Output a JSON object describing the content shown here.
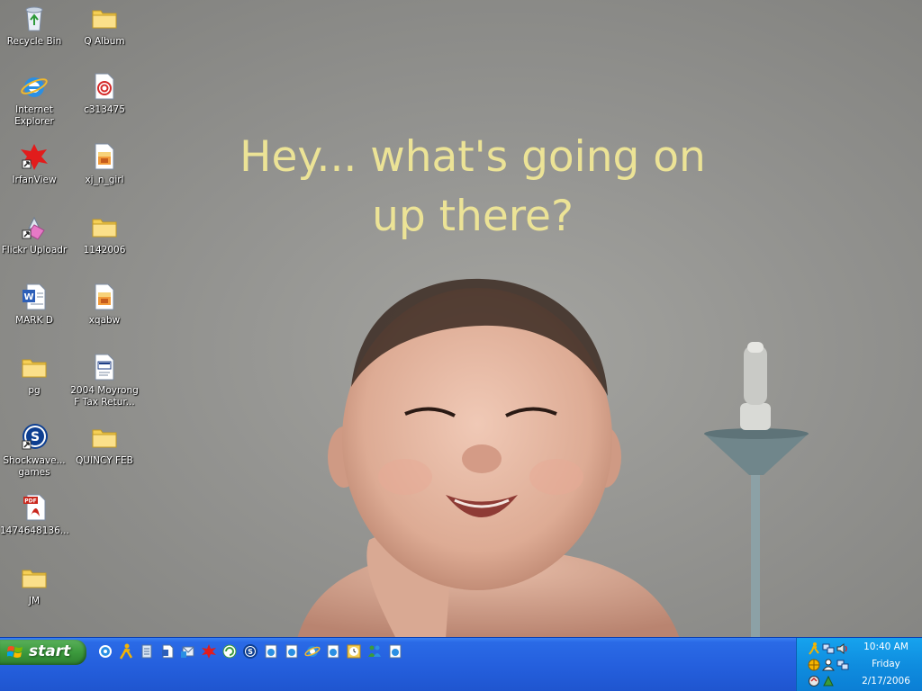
{
  "wallpaper": {
    "caption_line1": "Hey... what's going on",
    "caption_line2": "up there?"
  },
  "desktop_icons": [
    {
      "label": "Recycle Bin",
      "icon": "recycle-bin-icon"
    },
    {
      "label": "Q Album",
      "icon": "folder-icon"
    },
    {
      "label": "Internet Explorer",
      "icon": "internet-explorer-icon"
    },
    {
      "label": "c313475",
      "icon": "document-icon"
    },
    {
      "label": "IrfanView",
      "icon": "irfanview-icon"
    },
    {
      "label": "xj_n_girl",
      "icon": "image-file-icon"
    },
    {
      "label": "Flickr Uploadr",
      "icon": "flickr-uploadr-icon"
    },
    {
      "label": "1142006",
      "icon": "folder-icon"
    },
    {
      "label": "MARK D",
      "icon": "word-document-icon"
    },
    {
      "label": "xqabw",
      "icon": "image-file-icon"
    },
    {
      "label": "pg",
      "icon": "folder-icon"
    },
    {
      "label": "2004 Moyrong F Tax Retur...",
      "icon": "tax-document-icon"
    },
    {
      "label": "Shockwave... games",
      "icon": "shockwave-icon"
    },
    {
      "label": "QUINCY FEB",
      "icon": "folder-icon"
    },
    {
      "label": "1474648136...",
      "icon": "pdf-icon"
    },
    {
      "label": "JM",
      "icon": "folder-icon"
    }
  ],
  "taskbar": {
    "start_label": "start",
    "quick_launch": [
      "ie-settings-icon",
      "aim-icon",
      "notepad-icon",
      "document-icon",
      "mail-icon",
      "irfanview-icon",
      "refresh-icon",
      "shockwave-icon",
      "ie-page-icon",
      "ie-page-icon",
      "internet-explorer-icon",
      "ie-page-icon",
      "clock-icon",
      "windows-messenger-icon",
      "ie-page-icon"
    ],
    "clock": {
      "time": "10:40 AM",
      "day": "Friday",
      "date": "2/17/2006"
    }
  },
  "colors": {
    "caption": "#ece396",
    "taskbar": "#2560de",
    "tray": "#0f8ddf",
    "start": "#3c9a3d"
  }
}
